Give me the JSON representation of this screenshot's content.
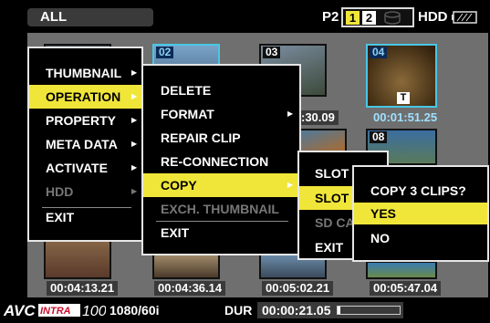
{
  "header": {
    "filter": "ALL",
    "media_label": "P2",
    "slots": [
      "1",
      "2"
    ],
    "hdd_label": "HDD",
    "accent": "#f0e63a"
  },
  "thumbnails": {
    "row1": [
      {
        "num": "",
        "time": ""
      },
      {
        "num": "02",
        "time": ""
      },
      {
        "num": "03",
        "time": ":30.09"
      },
      {
        "num": "04",
        "time": "00:01:51.25"
      }
    ],
    "row2": [
      {
        "num": "08"
      }
    ],
    "row3_times": [
      "00:04:13.21",
      "00:04:36.14",
      "00:05:02.21",
      "00:05:47.04"
    ],
    "mark": "T"
  },
  "menu_main": {
    "items": [
      "THUMBNAIL",
      "OPERATION",
      "PROPERTY",
      "META DATA",
      "ACTIVATE",
      "HDD",
      "EXIT"
    ],
    "selected": "OPERATION"
  },
  "menu_operation": {
    "items": [
      "DELETE",
      "FORMAT",
      "REPAIR CLIP",
      "RE-CONNECTION",
      "COPY",
      "EXCH. THUMBNAIL",
      "EXIT"
    ],
    "selected": "COPY"
  },
  "menu_copy": {
    "items": [
      "SLOT",
      "SLOT",
      "SD CA",
      "EXIT"
    ]
  },
  "dialog": {
    "title": "COPY 3 CLIPS?",
    "yes": "YES",
    "no": "NO"
  },
  "footer": {
    "codec_logo": "AVC INTRA 100",
    "format": "1080/60i",
    "dur_label": "DUR",
    "dur_value": "00:00:21.05",
    "dur_progress": 0.05
  }
}
